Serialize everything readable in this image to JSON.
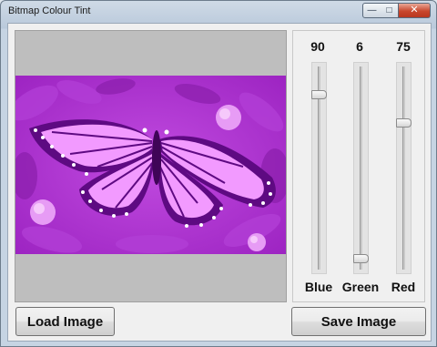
{
  "window": {
    "title": "Bitmap Colour Tint",
    "minimize_glyph": "—",
    "maximize_glyph": "□",
    "close_glyph": "✕"
  },
  "picture": {
    "tint_color": "#c83ae6",
    "icon": "butterfly-image"
  },
  "sliders": [
    {
      "id": "blue",
      "label": "Blue",
      "value": "90",
      "position": 0.87
    },
    {
      "id": "green",
      "label": "Green",
      "value": "6",
      "position": 0.05
    },
    {
      "id": "red",
      "label": "Red",
      "value": "75",
      "position": 0.73
    }
  ],
  "buttons": {
    "load_label": "Load Image",
    "save_label": "Save Image"
  }
}
